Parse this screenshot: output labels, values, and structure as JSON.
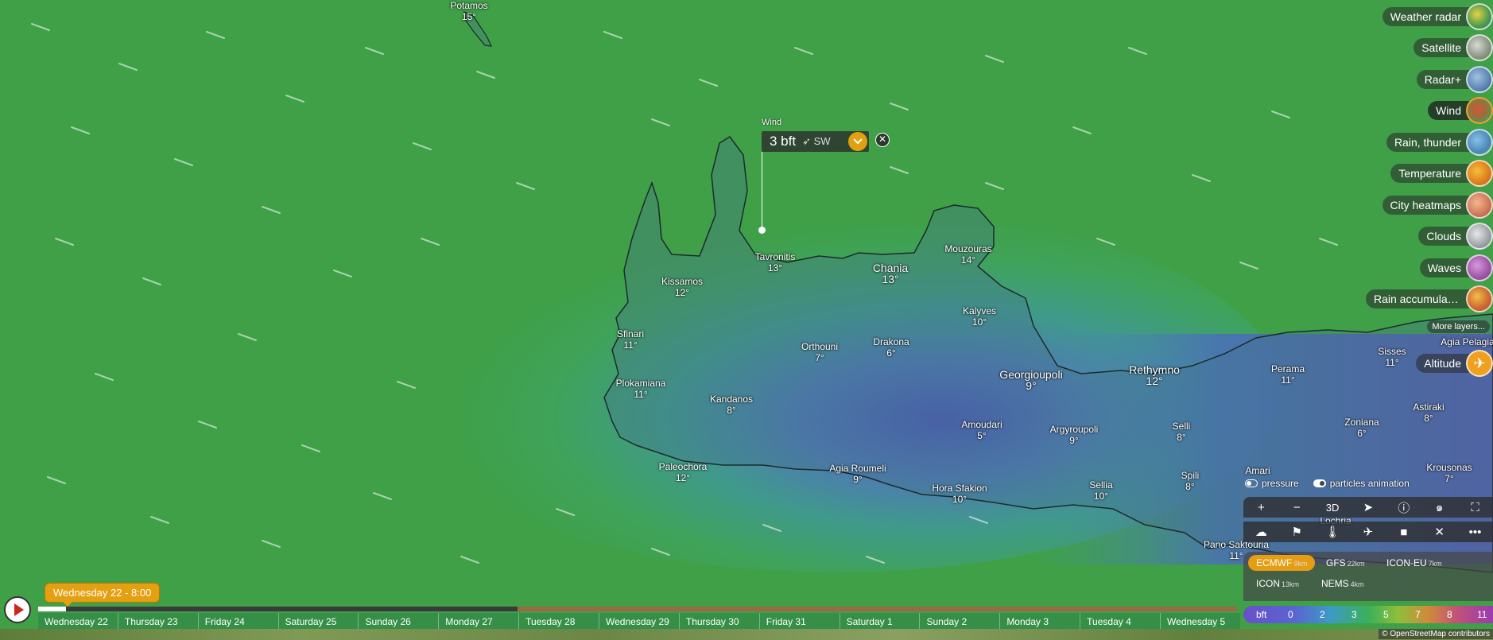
{
  "map": {
    "places": [
      {
        "name": "Potamos",
        "temp": "15°",
        "big": false
      },
      {
        "name": "Tavronitis",
        "temp": "13°",
        "big": false
      },
      {
        "name": "Kissamos",
        "temp": "12°",
        "big": false
      },
      {
        "name": "Chania",
        "temp": "13°",
        "big": true
      },
      {
        "name": "Mouzouras",
        "temp": "14°",
        "big": false
      },
      {
        "name": "Kalyves",
        "temp": "10°",
        "big": false
      },
      {
        "name": "Sfinari",
        "temp": "11°",
        "big": false
      },
      {
        "name": "Orthouni",
        "temp": "7°",
        "big": false
      },
      {
        "name": "Drakona",
        "temp": "6°",
        "big": false
      },
      {
        "name": "Georgioupoli",
        "temp": "9°",
        "big": true
      },
      {
        "name": "Rethymno",
        "temp": "12°",
        "big": true
      },
      {
        "name": "Perama",
        "temp": "11°",
        "big": false
      },
      {
        "name": "Sisses",
        "temp": "11°",
        "big": false
      },
      {
        "name": "Agia Pelagia",
        "temp": "",
        "big": false
      },
      {
        "name": "Plokamiana",
        "temp": "11°",
        "big": false
      },
      {
        "name": "Kandanos",
        "temp": "8°",
        "big": false
      },
      {
        "name": "Amoudari",
        "temp": "5°",
        "big": false
      },
      {
        "name": "Argyroupoli",
        "temp": "9°",
        "big": false
      },
      {
        "name": "Selli",
        "temp": "8°",
        "big": false
      },
      {
        "name": "Astiraki",
        "temp": "8°",
        "big": false
      },
      {
        "name": "Zoniana",
        "temp": "6°",
        "big": false
      },
      {
        "name": "Paleochora",
        "temp": "12°",
        "big": false
      },
      {
        "name": "Agia Roumeli",
        "temp": "9°",
        "big": false
      },
      {
        "name": "Hora Sfakion",
        "temp": "10°",
        "big": false
      },
      {
        "name": "Sellia",
        "temp": "10°",
        "big": false
      },
      {
        "name": "Spili",
        "temp": "8°",
        "big": false
      },
      {
        "name": "Amari",
        "temp": "",
        "big": false
      },
      {
        "name": "Krousonas",
        "temp": "7°",
        "big": false
      },
      {
        "name": "Lochria",
        "temp": "",
        "big": false
      },
      {
        "name": "Pano Saktouria",
        "temp": "11°",
        "big": false
      }
    ]
  },
  "popup": {
    "title": "Wind",
    "value": "3 bft",
    "direction": "SW"
  },
  "layers": [
    {
      "label": "Weather radar",
      "color": "#c9b03a",
      "active": false
    },
    {
      "label": "Satellite",
      "color": "#8e9a86",
      "active": false
    },
    {
      "label": "Radar+",
      "color": "#5b86b3",
      "active": false
    },
    {
      "label": "Wind",
      "color": "#a36a3a",
      "active": true
    },
    {
      "label": "Rain, thunder",
      "color": "#4c88b8",
      "active": false
    },
    {
      "label": "Temperature",
      "color": "#e0821e",
      "active": false
    },
    {
      "label": "City heatmaps",
      "color": "#d27c5c",
      "active": false
    },
    {
      "label": "Clouds",
      "color": "#a4a8ac",
      "active": false
    },
    {
      "label": "Waves",
      "color": "#a25aa6",
      "active": false
    },
    {
      "label": "Rain accumulati...",
      "color": "#d2742e",
      "active": false
    }
  ],
  "more_layers": "More layers...",
  "altitude": "Altitude",
  "toggles": {
    "pressure": "pressure",
    "particles": "particles animation"
  },
  "controls": {
    "zoom_in": "+",
    "zoom_out": "−",
    "three_d": "3D"
  },
  "models": [
    {
      "name": "ECMWF",
      "res": "9km",
      "selected": true
    },
    {
      "name": "GFS",
      "res": "22km",
      "selected": false
    },
    {
      "name": "ICON-EU",
      "res": "7km",
      "selected": false
    },
    {
      "name": "ICON",
      "res": "13km",
      "selected": false
    },
    {
      "name": "NEMS",
      "res": "4km",
      "selected": false
    }
  ],
  "scale": {
    "unit": "bft",
    "ticks": [
      "0",
      "2",
      "3",
      "5",
      "7",
      "8",
      "11"
    ]
  },
  "timeline": {
    "current": "Wednesday 22 - 8:00",
    "days": [
      "Wednesday 22",
      "Thursday 23",
      "Friday 24",
      "Saturday 25",
      "Sunday 26",
      "Monday 27",
      "Tuesday 28",
      "Wednesday 29",
      "Thursday 30",
      "Friday 31",
      "Saturday 1",
      "Sunday 2",
      "Monday 3",
      "Tuesday 4",
      "Wednesday 5"
    ]
  },
  "attribution": "© OpenStreetMap contributors"
}
